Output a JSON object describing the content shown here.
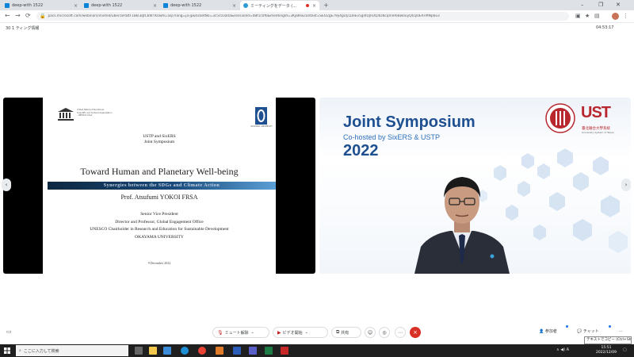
{
  "browser": {
    "tabs": [
      {
        "label": "deep-with 1522"
      },
      {
        "label": "deep-with 1522"
      },
      {
        "label": "deep-with 1522"
      },
      {
        "label": "ミーティングをデータ (..."
      }
    ],
    "new_tab": "+",
    "url": "pacs.microsoft.com/webinars/invited/uber/aFtBtF1Bkl3qtCbWTKUwhu.asp?lang=ja-jp&ticketNo=3c5c03a0a&sessionId=d8f1c0f6&meetingId=3KyBR&context=SEO2gE79y4gUyLDeEv5gI4UJnOQ4DBcqVnR68w0uyQtcp0EhFMNp6o3",
    "nav": {
      "back": "←",
      "forward": "→",
      "reload": "⟳"
    },
    "window": {
      "minimize": "–",
      "maximize": "❐",
      "close": "✕"
    }
  },
  "meeting": {
    "header_left": "30 1  ティング情報",
    "header_right": "04:53:17",
    "controls": {
      "mic_label": "ミュート解除",
      "video_label": "ビデオ開始",
      "share_label": "共有",
      "leave_icon": "×"
    },
    "right_controls": {
      "participants_label": "参加者",
      "chat_label": "チャット",
      "more": "..."
    },
    "tooltip": "テキストでコピー (Ctrl+Shift+R)"
  },
  "slide": {
    "unesco_text": "United Nations Educational, Scientific and Cultural Organization · UNESCO Chair",
    "university_mark": "OKAYAMA UNIVERSITY",
    "org_line1": "USTP and SixERS",
    "org_line2": "Joint Symposium",
    "title": "Toward Human and Planetary Well-being",
    "subtitle": "Synergies between the SDGs and Climate Action",
    "author": "Prof. Atsufumi YOKOI FRSA",
    "roles": [
      "Senior Vice President",
      "Director and Professor, Global Engagement Office",
      "UNESCO Chairholder in Research and Education for Sustainable Development",
      "OKAYAMA UNIVERSITY"
    ],
    "date": "9 December 2022"
  },
  "speaker": {
    "banner_title": "Joint Symposium",
    "banner_sub": "Co-hosted by SixERS & USTP",
    "banner_year": "2022",
    "ust_logo": "UST",
    "ust_cn": "臺北聯合大學系統",
    "ust_en": "University System of Taipei"
  },
  "taskbar": {
    "search_placeholder": "ここに入力して検索",
    "time": "15:51",
    "date": "2022/12/09",
    "tray_text": "∧  ◀)  A"
  },
  "colors": {
    "accent_blue": "#1a73e8",
    "leave_red": "#d93025",
    "symposium_blue": "#1d4f91",
    "ust_red": "#b8262e"
  }
}
